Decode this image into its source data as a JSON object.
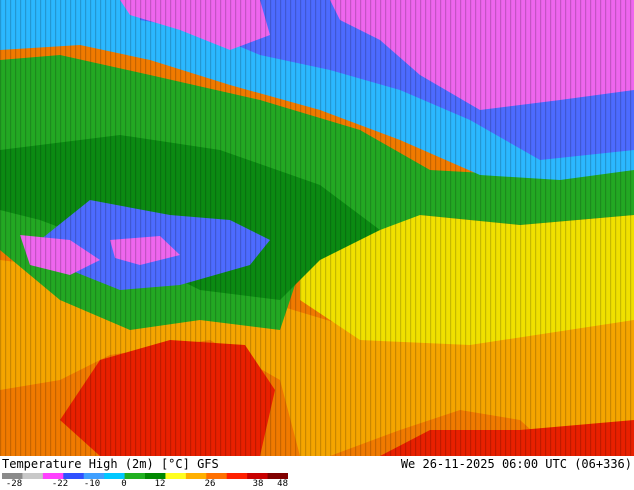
{
  "title": "Temperature High (2m) [°C] GFS",
  "validity": "We 26-11-2025 06:00 UTC (06+336)",
  "scale": {
    "ticks": [
      "-28",
      "-22",
      "-10",
      "0",
      "12",
      "26",
      "38",
      "48"
    ],
    "colors": [
      "#8a8a8a",
      "#c8c8c8",
      "#ff40ff",
      "#3050ff",
      "#40a0ff",
      "#00c8ff",
      "#20b020",
      "#008800",
      "#ffff20",
      "#ffb000",
      "#ff7000",
      "#ff2000",
      "#c80000",
      "#800000"
    ]
  },
  "zones": {
    "cold_magenta": "#ee66ee",
    "cold_blue": "#4d6bff",
    "cool_cyan": "#2bb8ff",
    "mild_green": "#23a823",
    "dark_green": "#0b8a12",
    "warm_yellow": "#f0e000",
    "warm_orange": "#f5a500",
    "hot_orange": "#f07a00",
    "hot_red": "#e82000"
  }
}
